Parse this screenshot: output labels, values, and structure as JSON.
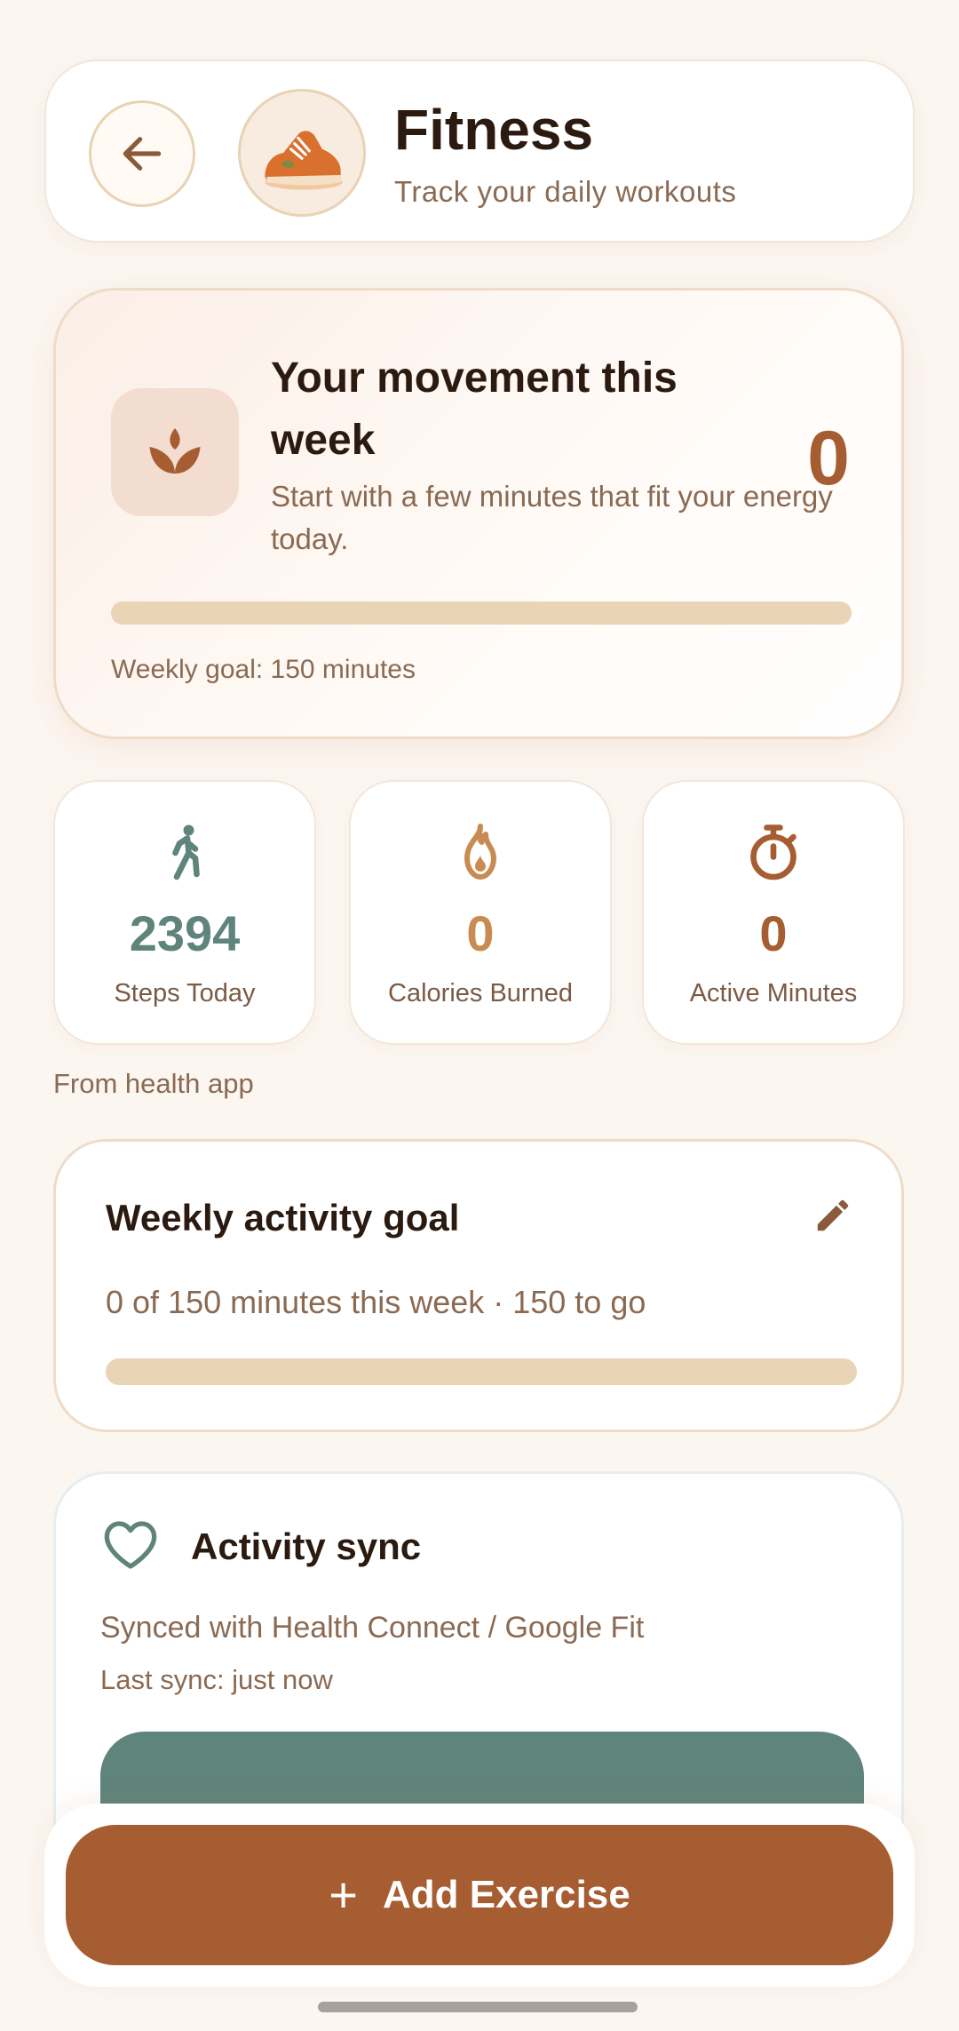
{
  "header": {
    "title": "Fitness",
    "subtitle": "Track your daily workouts",
    "back_icon": "arrow-left-icon",
    "avatar_icon": "sneaker-icon"
  },
  "movement": {
    "title": "Your movement this week",
    "subtitle": "Start with a few minutes that fit your energy today.",
    "count": "0",
    "progress_fraction": 0,
    "goal_text": "Weekly goal: 150 minutes",
    "icon": "lotus-icon"
  },
  "stats": [
    {
      "value": "2394",
      "label": "Steps Today",
      "icon": "walking-icon",
      "color": "#5f847b"
    },
    {
      "value": "0",
      "label": "Calories Burned",
      "icon": "flame-icon",
      "color": "#c98b52"
    },
    {
      "value": "0",
      "label": "Active Minutes",
      "icon": "stopwatch-icon",
      "color": "#a65d31"
    }
  ],
  "health_note": "From health app",
  "weekly_goal": {
    "title": "Weekly activity goal",
    "progress_text": "0 of 150 minutes this week · 150 to go",
    "progress_fraction": 0,
    "edit_icon": "pencil-icon"
  },
  "sync": {
    "title": "Activity sync",
    "status": "Synced with Health Connect / Google Fit",
    "last_sync": "Last sync: just now",
    "icon": "heart-icon"
  },
  "add_button": {
    "label": "Add Exercise",
    "icon": "plus-icon"
  },
  "colors": {
    "background": "#fcf6f1",
    "accent": "#a65d31",
    "sage": "#5f847b",
    "bar_track": "#ead4b6"
  }
}
